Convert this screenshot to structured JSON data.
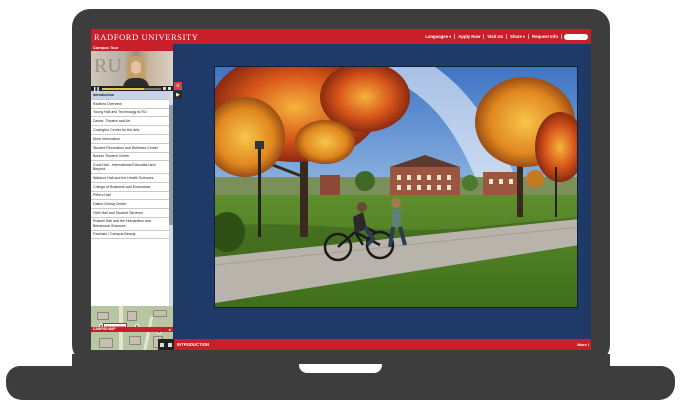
{
  "app": {
    "brand": "RADFORD UNIVERSITY"
  },
  "topnav": [
    {
      "label": "Languages",
      "has_caret": true
    },
    {
      "label": "Apply Now",
      "has_caret": false
    },
    {
      "label": "Visit Us",
      "has_caret": false
    },
    {
      "label": "Share",
      "has_caret": true
    },
    {
      "label": "Request Info",
      "has_caret": false
    }
  ],
  "panel": {
    "title": "Campus Tour",
    "video_bg_text": "RU",
    "video_progress": 0.72
  },
  "tour_stops": [
    {
      "label": "Introduction",
      "active": true
    },
    {
      "label": "Radford Overview",
      "active": false
    },
    {
      "label": "Young Hall and Technology at RU",
      "active": false
    },
    {
      "label": "Dance, Theatre and Art",
      "active": false
    },
    {
      "label": "Covington Center for the Arts",
      "active": false
    },
    {
      "label": "More Information",
      "active": false
    },
    {
      "label": "Student Recreation and Wellness Center",
      "active": false
    },
    {
      "label": "Bonnie Student Center",
      "active": false
    },
    {
      "label": "Cook Hall - International Education and Beyond",
      "active": false
    },
    {
      "label": "Waldron Hall and the Health Sciences",
      "active": false
    },
    {
      "label": "College of Business and Economics",
      "active": false
    },
    {
      "label": "Peters Hall",
      "active": false
    },
    {
      "label": "Dalton Dining Center",
      "active": false
    },
    {
      "label": "Heth Hall and Student Services",
      "active": false
    },
    {
      "label": "Russell Hall and the Humanities and Behavioral Sciences",
      "active": false
    },
    {
      "label": "Fountain / Campus Beauty",
      "active": false
    }
  ],
  "map": {
    "bar_label": "CAMPUS MAP",
    "pin_label": "Introduction"
  },
  "bottom": {
    "current_stop": "INTRODUCTION",
    "more_label": "More I"
  },
  "colors": {
    "brand_red": "#c81f2a",
    "screen_bg": "#1f3a66",
    "laptop": "#3d3d3d"
  }
}
